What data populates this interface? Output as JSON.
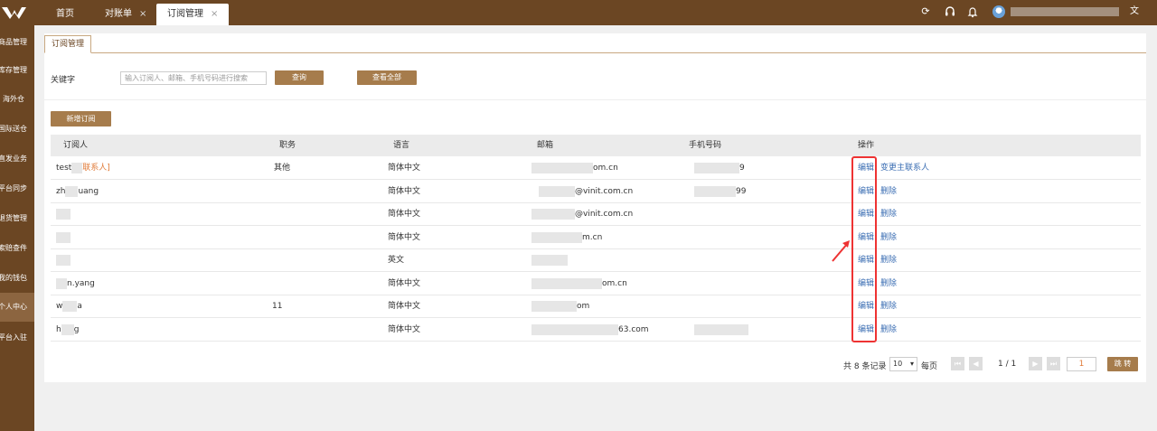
{
  "tabs": [
    {
      "label": "首页"
    },
    {
      "label": "对账单"
    },
    {
      "label": "订阅管理"
    }
  ],
  "sidebar": {
    "items": [
      {
        "label": "商品管理"
      },
      {
        "label": "库存管理"
      },
      {
        "label": "海外仓"
      },
      {
        "label": "国际送仓"
      },
      {
        "label": "直发业务"
      },
      {
        "label": "平台同步"
      },
      {
        "label": "退货管理"
      },
      {
        "label": "索赔查件"
      },
      {
        "label": "我的钱包"
      },
      {
        "label": "个人中心"
      },
      {
        "label": "平台入驻"
      }
    ]
  },
  "page_tab": "订阅管理",
  "search": {
    "label": "关键字",
    "placeholder": "输入订阅人、邮箱、手机号码进行搜索",
    "query_label": "查询",
    "view_all_label": "查看全部"
  },
  "add_label": "新增订阅",
  "table": {
    "headers": [
      "订阅人",
      "职务",
      "语言",
      "邮箱",
      "手机号码",
      "操作"
    ],
    "rows": [
      {
        "name": "test",
        "tag": "联系人]",
        "role": "其他",
        "lang": "简体中文",
        "email": "om.cn",
        "phone": "9",
        "edit": "编辑",
        "op2": "变更主联系人"
      },
      {
        "name": "zh",
        "name2": "uang",
        "role": "",
        "lang": "简体中文",
        "email": "@vinit.com.cn",
        "phone": "99",
        "edit": "编辑",
        "op2": "删除"
      },
      {
        "name": "",
        "role": "",
        "lang": "简体中文",
        "email": "@vinit.com.cn",
        "phone": "",
        "edit": "编辑",
        "op2": "删除"
      },
      {
        "name": "",
        "role": "",
        "lang": "简体中文",
        "email": "m.cn",
        "phone": "",
        "edit": "编辑",
        "op2": "删除"
      },
      {
        "name": "",
        "role": "",
        "lang": "英文",
        "email": "",
        "phone": "",
        "edit": "编辑",
        "op2": "删除"
      },
      {
        "name": "n.yang",
        "role": "",
        "lang": "简体中文",
        "email": "om.cn",
        "phone": "",
        "edit": "编辑",
        "op2": "删除"
      },
      {
        "name": "w",
        "name2": "a",
        "role": "11",
        "lang": "简体中文",
        "email": "om",
        "phone": "",
        "edit": "编辑",
        "op2": "删除"
      },
      {
        "name": "h",
        "name2": "g",
        "role": "",
        "lang": "简体中文",
        "email": "63.com",
        "phone": "",
        "edit": "编辑",
        "op2": "删除"
      }
    ]
  },
  "pagination": {
    "total_label": "共 8 条记录",
    "page_size": "10",
    "per_page_label": "每页",
    "page_info": "1 / 1",
    "jump_value": "1",
    "jump_label": "跳 转"
  },
  "colors": {
    "brand": "#6b4623",
    "button": "#a67c4c",
    "link": "#3b6eb3",
    "highlight": "#e33333"
  }
}
